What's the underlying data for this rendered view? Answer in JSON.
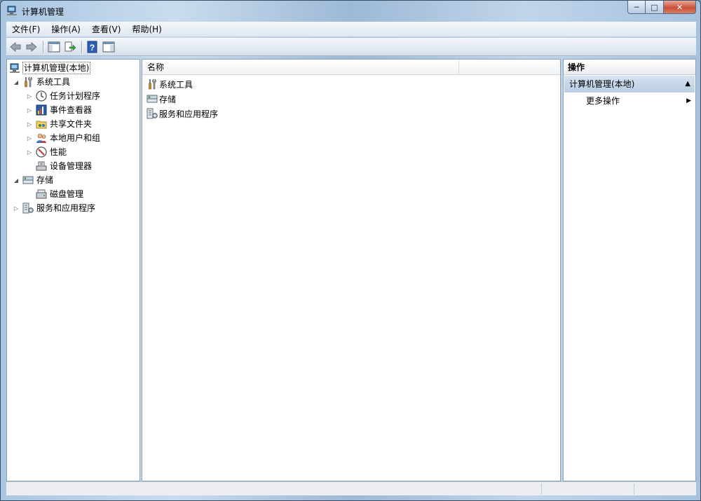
{
  "window": {
    "title": "计算机管理",
    "minimize": "─",
    "maximize": "□",
    "close": "✕"
  },
  "menu": [
    "文件(F)",
    "操作(A)",
    "查看(V)",
    "帮助(H)"
  ],
  "toolbar": {
    "icons": [
      "back-icon",
      "forward-icon",
      "show-hide-console-tree-icon",
      "export-list-icon",
      "help-icon",
      "show-hide-action-pane-icon"
    ]
  },
  "tree": {
    "root": "计算机管理(本地)",
    "items": [
      {
        "label": "系统工具",
        "level": 1,
        "expander": "expanded",
        "icon": "tools-icon"
      },
      {
        "label": "任务计划程序",
        "level": 2,
        "expander": "collapsed",
        "icon": "clock-icon"
      },
      {
        "label": "事件查看器",
        "level": 2,
        "expander": "collapsed",
        "icon": "event-viewer-icon"
      },
      {
        "label": "共享文件夹",
        "level": 2,
        "expander": "collapsed",
        "icon": "shared-folder-icon"
      },
      {
        "label": "本地用户和组",
        "level": 2,
        "expander": "collapsed",
        "icon": "users-icon"
      },
      {
        "label": "性能",
        "level": 2,
        "expander": "collapsed",
        "icon": "performance-icon"
      },
      {
        "label": "设备管理器",
        "level": 2,
        "expander": "none",
        "icon": "device-manager-icon"
      },
      {
        "label": "存储",
        "level": 1,
        "expander": "expanded",
        "icon": "storage-icon"
      },
      {
        "label": "磁盘管理",
        "level": 2,
        "expander": "none",
        "icon": "disk-icon"
      },
      {
        "label": "服务和应用程序",
        "level": 1,
        "expander": "collapsed",
        "icon": "services-icon"
      }
    ]
  },
  "list": {
    "column": "名称",
    "rows": [
      {
        "label": "系统工具",
        "icon": "tools-icon"
      },
      {
        "label": "存储",
        "icon": "storage-icon"
      },
      {
        "label": "服务和应用程序",
        "icon": "services-icon"
      }
    ]
  },
  "actions": {
    "header": "操作",
    "group": "计算机管理(本地)",
    "item": "更多操作"
  }
}
